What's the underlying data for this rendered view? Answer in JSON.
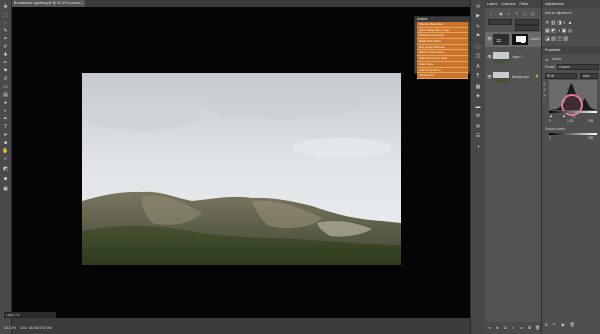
{
  "document": {
    "tab_title": "Brooklands Lightning.tif @ 33.3% (Levels 1, Layer Mask/8) *",
    "zoom": "33.33%",
    "doc_info": "Doc: 48.0M/152.0M"
  },
  "layer_popup": "Layer 2 ▸",
  "actions_panel": {
    "title": "Actions",
    "items": [
      "Sharpen Blue Filter",
      "Old S Dodge Burn Layer",
      "Default Actions (sel)",
      "Black Point Alpha",
      "Red Image Midtones",
      "Black & White Layer",
      "Dark Sky Curves Fade",
      "Halo Image",
      "Soft Punch Boost",
      "Vignette Pro"
    ]
  },
  "layers_panel": {
    "tabs": [
      "Layers",
      "Channels",
      "Paths"
    ],
    "layers": [
      {
        "name": "Levels 1",
        "type": "adjustment"
      },
      {
        "name": "Layer 2",
        "type": "pixel"
      },
      {
        "name": "Background",
        "type": "background"
      }
    ]
  },
  "adjustments_panel": {
    "title": "Adjustments",
    "subtitle": "Add an adjustment"
  },
  "properties_panel": {
    "title": "Properties",
    "label": "Levels",
    "preset_label": "Preset:",
    "preset_value": "Custom",
    "channel_value": "RGB",
    "auto_label": "Auto",
    "input_values": [
      "0",
      "1.00",
      "255"
    ],
    "output_label": "Output Levels:",
    "output_values": [
      "0",
      "255"
    ]
  },
  "colors": {
    "actions_highlight": "#c9742a",
    "panel_bg": "#535353",
    "canvas_bg": "#050505",
    "annotation_circle": "#e07a95"
  }
}
